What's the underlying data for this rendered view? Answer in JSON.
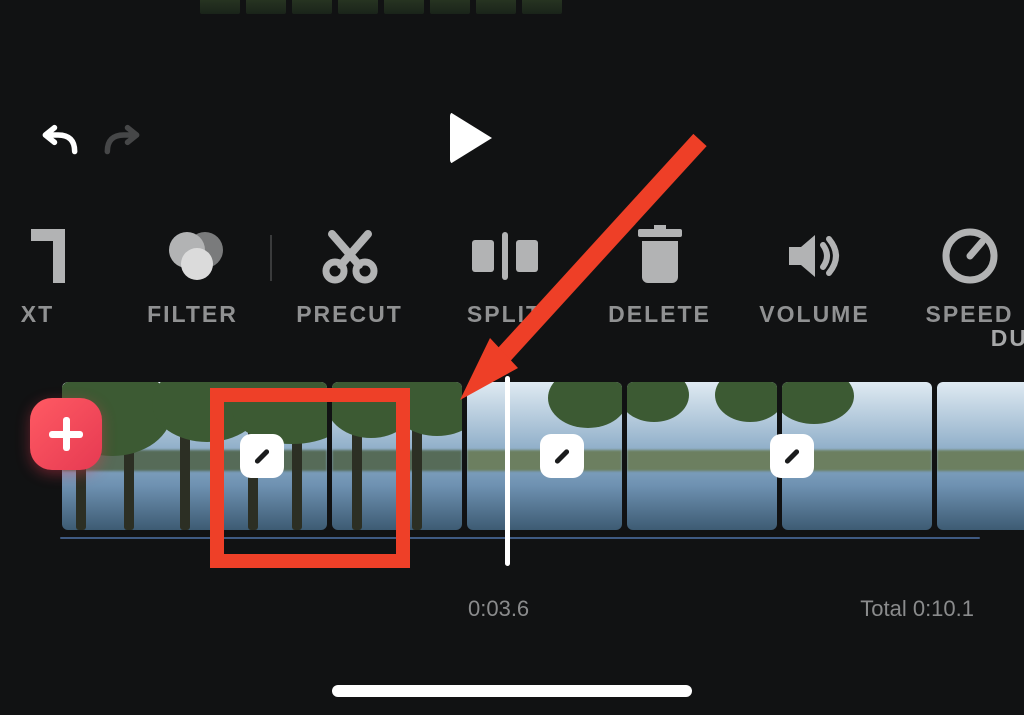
{
  "playback": {
    "current_time_label": "0:03.6",
    "total_time_label": "Total 0:10.1"
  },
  "toolbar": {
    "items": [
      {
        "id": "text",
        "label": "XT"
      },
      {
        "id": "filter",
        "label": "FILTER"
      },
      {
        "id": "precut",
        "label": "PRECUT"
      },
      {
        "id": "split",
        "label": "SPLIT"
      },
      {
        "id": "delete",
        "label": "DELETE"
      },
      {
        "id": "volume",
        "label": "VOLUME"
      },
      {
        "id": "speed",
        "label": "SPEED"
      },
      {
        "id": "duplicate",
        "label": "DU"
      }
    ]
  },
  "annotation": {
    "highlight_target": "first-transition-box"
  }
}
